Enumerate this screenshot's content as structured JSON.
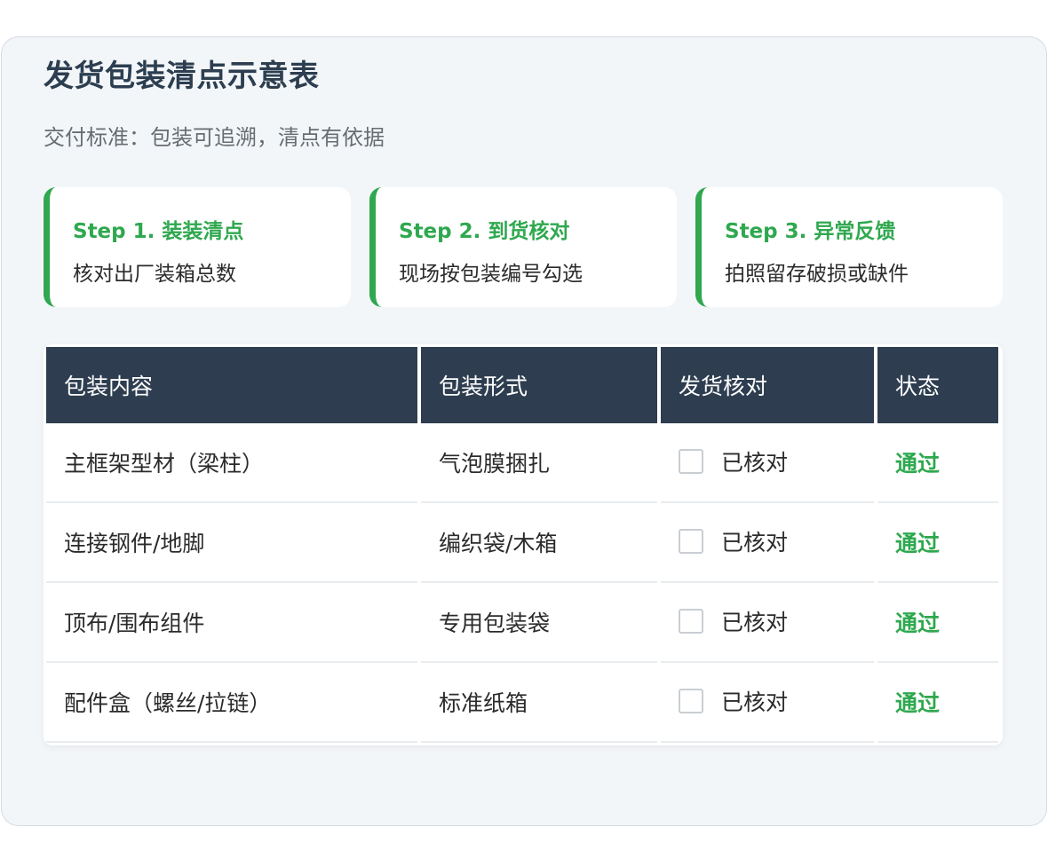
{
  "title": "发货包装清点示意表",
  "subtitle": "交付标准：包装可追溯，清点有依据",
  "steps": [
    {
      "title": "Step 1. 装装清点",
      "desc": "核对出厂装箱总数"
    },
    {
      "title": "Step 2. 到货核对",
      "desc": "现场按包装编号勾选"
    },
    {
      "title": "Step 3. 异常反馈",
      "desc": "拍照留存破损或缺件"
    }
  ],
  "colors": {
    "accent": "#2fa84f",
    "header_bg": "#2e3e50",
    "title": "#2c3e50"
  },
  "table": {
    "headers": [
      "包装内容",
      "包装形式",
      "发货核对",
      "状态"
    ],
    "rows": [
      {
        "content": "主框架型材（梁柱）",
        "form": "气泡膜捆扎",
        "check": "已核对",
        "checked": false,
        "status": "通过"
      },
      {
        "content": "连接钢件/地脚",
        "form": "编织袋/木箱",
        "check": "已核对",
        "checked": false,
        "status": "通过"
      },
      {
        "content": "顶布/围布组件",
        "form": "专用包装袋",
        "check": "已核对",
        "checked": false,
        "status": "通过"
      },
      {
        "content": "配件盒（螺丝/拉链）",
        "form": "标准纸箱",
        "check": "已核对",
        "checked": false,
        "status": "通过"
      }
    ]
  }
}
